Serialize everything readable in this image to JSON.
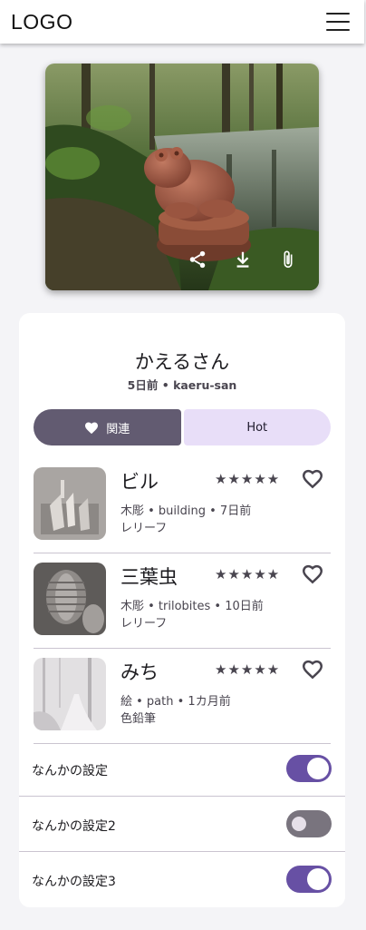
{
  "header": {
    "logo": "LOGO",
    "menu_icon": "hamburger-menu-icon"
  },
  "hero": {
    "image": "frog-statue-in-forest-photo",
    "actions": [
      {
        "icon": "share-icon"
      },
      {
        "icon": "download-icon"
      },
      {
        "icon": "paperclip-icon"
      }
    ]
  },
  "profile": {
    "title": "かえるさん",
    "subtitle": "5日前 • kaeru-san"
  },
  "tabs": [
    {
      "label": "関連",
      "icon": "heart-icon",
      "selected": true
    },
    {
      "label": "Hot",
      "selected": false
    }
  ],
  "items": [
    {
      "name": "ビル",
      "stars": "★★★★★",
      "meta": "木彫 • building • 7日前",
      "tag": "レリーフ",
      "favorite_icon": "heart-outline-icon"
    },
    {
      "name": "三葉虫",
      "stars": "★★★★★",
      "meta": "木彫 • trilobites • 10日前",
      "tag": "レリーフ",
      "favorite_icon": "heart-outline-icon"
    },
    {
      "name": "みち",
      "stars": "★★★★★",
      "meta": "絵 • path • 1カ月前",
      "tag": "色鉛筆",
      "favorite_icon": "heart-outline-icon"
    }
  ],
  "settings": [
    {
      "label": "なんかの設定",
      "on": true
    },
    {
      "label": "なんかの設定2",
      "on": false
    },
    {
      "label": "なんかの設定3",
      "on": true
    }
  ],
  "colors": {
    "primary": "#6750a4",
    "secondary": "#625b71",
    "secondary_container": "#e8def8",
    "background": "#f4f4f7"
  }
}
